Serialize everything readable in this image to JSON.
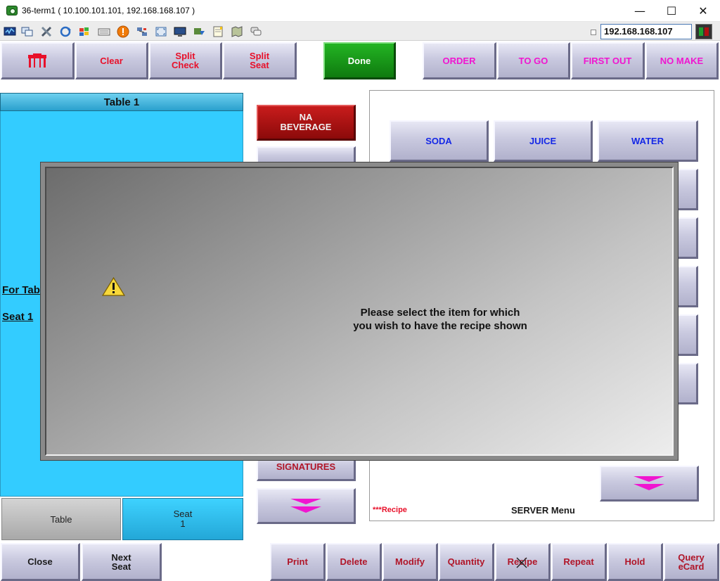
{
  "window": {
    "title": "36-term1 ( 10.100.101.101, 192.168.168.107 )",
    "minimize": "—",
    "maximize": "☐",
    "close": "✕"
  },
  "toolbar": {
    "ip_address": "192.168.168.107",
    "icons": [
      "monitor-icon",
      "windows-icon",
      "tools-icon",
      "refresh-icon",
      "palette-icon",
      "keyboard-icon",
      "alert-icon",
      "network-icon",
      "fullscreen-icon",
      "screen-icon",
      "transfer-icon",
      "notepad-icon",
      "map-icon",
      "chat-icon"
    ]
  },
  "top_bar": {
    "clear": "Clear",
    "split_check": [
      "Split",
      "Check"
    ],
    "split_seat": [
      "Split",
      "Seat"
    ],
    "done": "Done",
    "order": "ORDER",
    "to_go": "TO GO",
    "first_out": "FIRST OUT",
    "no_make": "NO MAKE"
  },
  "order": {
    "header": "Table 1",
    "line1": "For Tab",
    "line2": "Seat 1",
    "table_btn": "Table",
    "seat_btn": "Seat",
    "seat_num": "1"
  },
  "categories": {
    "na_beverage": [
      "NA",
      "BEVERAGE"
    ],
    "signatures": "SIGNATURES"
  },
  "items": [
    "SODA",
    "JUICE",
    "WATER"
  ],
  "dialog": {
    "message": [
      "Please select the item for which",
      "you wish to have the recipe shown"
    ]
  },
  "footer": {
    "recipe_note": "***Recipe",
    "menu_title": "SERVER Menu",
    "close": "Close",
    "next_seat": [
      "Next",
      "Seat"
    ],
    "print": "Print",
    "delete": "Delete",
    "modify": "Modify",
    "quantity": "Quantity",
    "recipe": "Recipe",
    "repeat": "Repeat",
    "hold": "Hold",
    "query_ecard": [
      "Query",
      "eCard"
    ]
  },
  "colors": {
    "accent_red": "#e8102a",
    "accent_magenta": "#f015d0",
    "accent_blue": "#1427e6",
    "done_green": "#1c9a1c",
    "order_panel": "#33ccff"
  }
}
